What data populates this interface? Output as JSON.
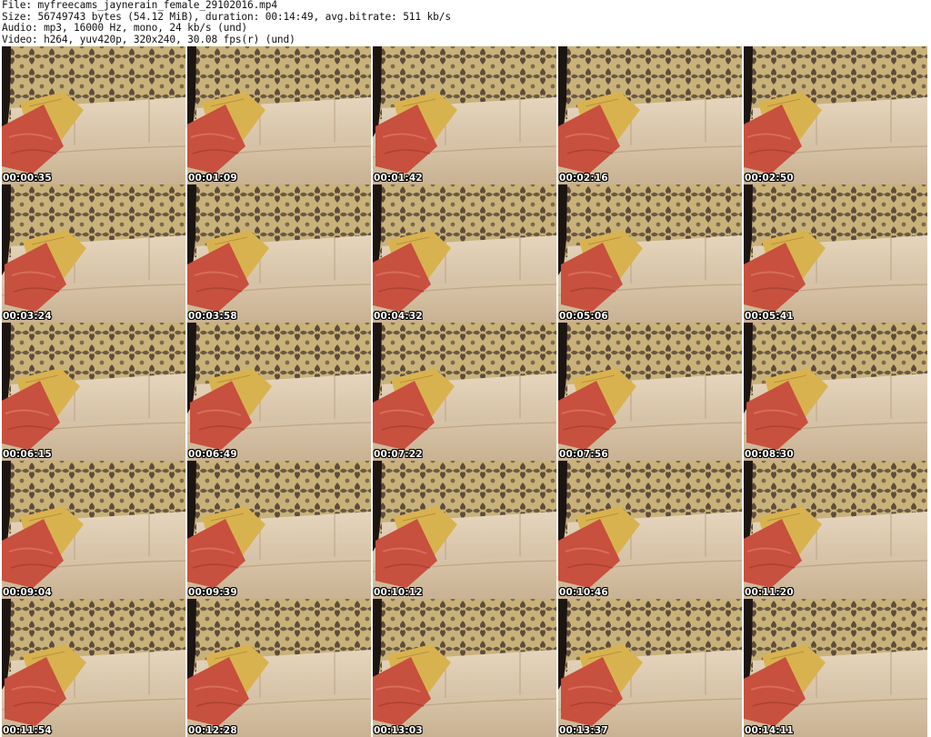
{
  "header": {
    "file_line": "File: myfreecams_jaynerain_female_29102016.mp4",
    "size_line": "Size: 56749743 bytes (54.12 MiB), duration: 00:14:49, avg.bitrate: 511 kb/s",
    "audio_line": "Audio: mp3, 16000 Hz, mono, 24 kb/s (und)",
    "video_line": "Video: h264, yuv420p, 320x240, 30.08 fps(r) (und)"
  },
  "thumbnails": [
    {
      "time": "00:00:35"
    },
    {
      "time": "00:01:09"
    },
    {
      "time": "00:01:42"
    },
    {
      "time": "00:02:16"
    },
    {
      "time": "00:02:50"
    },
    {
      "time": "00:03:24"
    },
    {
      "time": "00:03:58"
    },
    {
      "time": "00:04:32"
    },
    {
      "time": "00:05:06"
    },
    {
      "time": "00:05:41"
    },
    {
      "time": "00:06:15"
    },
    {
      "time": "00:06:49"
    },
    {
      "time": "00:07:22"
    },
    {
      "time": "00:07:56"
    },
    {
      "time": "00:08:30"
    },
    {
      "time": "00:09:04"
    },
    {
      "time": "00:09:39"
    },
    {
      "time": "00:10:12"
    },
    {
      "time": "00:10:46"
    },
    {
      "time": "00:11:20"
    },
    {
      "time": "00:11:54"
    },
    {
      "time": "00:12:28"
    },
    {
      "time": "00:13:03"
    },
    {
      "time": "00:13:37"
    },
    {
      "time": "00:14:11"
    }
  ],
  "colors": {
    "wallpaper_base": "#c9b27a",
    "wallpaper_pattern": "#4a3a30",
    "sofa": "#e0cdb4",
    "sofa_shadow": "#c4ad90",
    "pillow_red": "#c8503e",
    "pillow_yellow": "#d9b250",
    "frame_dark": "#1d1512"
  }
}
